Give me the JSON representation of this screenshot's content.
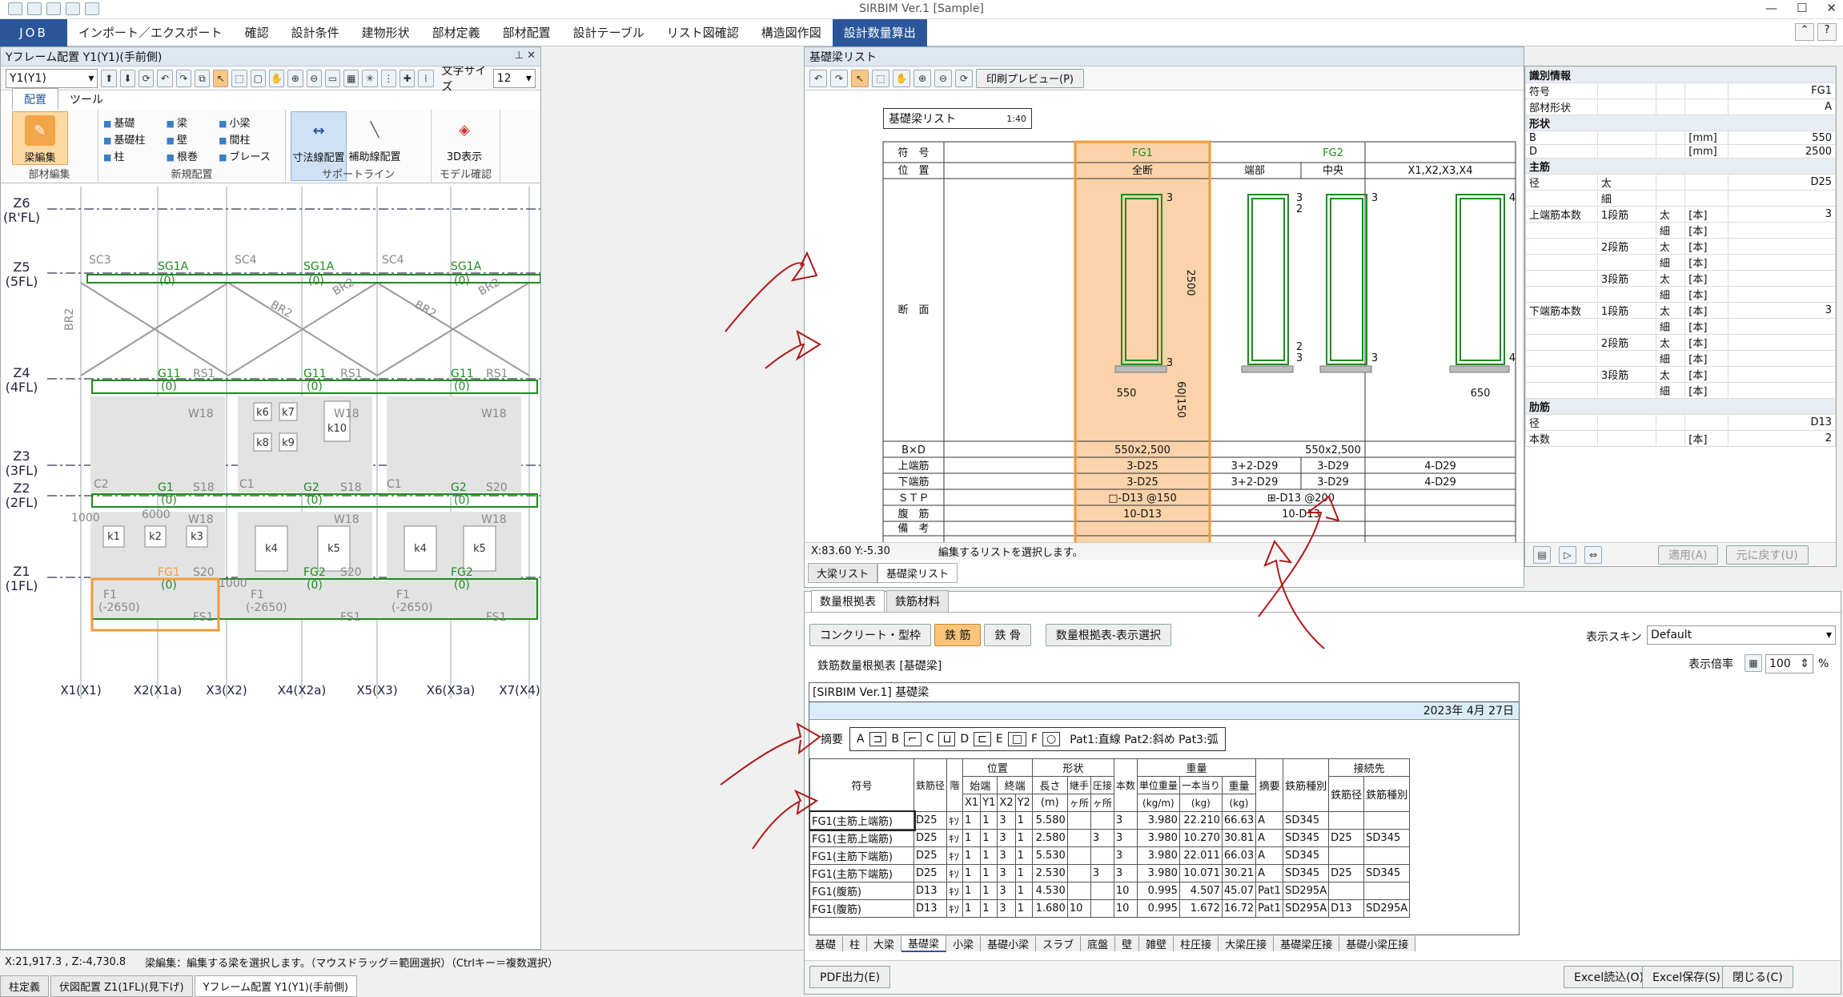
{
  "app": {
    "title": "SIRBIM Ver.1 [Sample]",
    "job": "JOB",
    "tabs": [
      "インポート／エクスポート",
      "確認",
      "設計条件",
      "建物形状",
      "部材定義",
      "部材配置",
      "設計テーブル",
      "リスト図確認",
      "構造図作図",
      "設計数量算出"
    ],
    "active_tab": "設計数量算出",
    "win_controls": [
      "—",
      "☐",
      "✕"
    ]
  },
  "left": {
    "panel_title": "Yフレーム配置 Y1(Y1)(手前側)",
    "frame_select": "Y1(Y1)",
    "font_size_label": "文字サイズ",
    "font_size_value": "12",
    "subtabs": [
      "配置",
      "ツール"
    ],
    "ribbon": {
      "edit_btn": "梁編集",
      "edit_group": "部材編集",
      "new_items": [
        "基礎",
        "梁",
        "小梁",
        "基礎柱",
        "壁",
        "間柱",
        "柱",
        "根巻",
        "ブレース"
      ],
      "new_group": "新規配置",
      "dim_btn": "寸法線配置",
      "aux_btn": "補助線配置",
      "support_group": "サポートライン",
      "view3d_btn": "3D表示",
      "model_group": "モデル確認"
    },
    "levels": [
      {
        "name": "Z6",
        "sub": "(R'FL)"
      },
      {
        "name": "Z5",
        "sub": "(5FL)"
      },
      {
        "name": "Z4",
        "sub": "(4FL)"
      },
      {
        "name": "Z3",
        "sub": "(3FL)"
      },
      {
        "name": "Z2",
        "sub": "(2FL)"
      },
      {
        "name": "Z1",
        "sub": "(1FL)"
      }
    ],
    "axes": [
      "X1(X1)",
      "X2(X1a)",
      "X3(X2)",
      "X4(X2a)",
      "X5(X3)",
      "X6(X3a)",
      "X7(X4)"
    ],
    "labels": {
      "sc3": "SC3",
      "sc4": "SC4",
      "sc4b": "SC4",
      "sg1a": "SG1A",
      "zero": "(0)",
      "br2": "BR2",
      "br2v": "BR2",
      "g11": "G11",
      "rs1": "RS1",
      "w18": "W18",
      "g1": "G1",
      "s18": "S18",
      "s20": "S20",
      "g2": "G2",
      "c2": "C2",
      "c1": "C1",
      "fg1": "FG1",
      "fg2": "FG2",
      "f1": "F1",
      "depth": "(-2650)",
      "fs1": "FS1",
      "dim6000": "6000",
      "dim1000": "1000",
      "k1": "k1",
      "k2": "k2",
      "k3": "k3",
      "k4": "k4",
      "k5": "k5",
      "k6": "k6",
      "k7": "k7",
      "k8": "k8",
      "k9": "k9",
      "k10": "k10"
    },
    "status_coord": "X:21,917.3 , Z:-4,730.8",
    "status_msg": "梁編集：編集する梁を選択します。（マウスドラッグ＝範囲選択）（Ctrlキー＝複数選択）",
    "doc_tabs": [
      "柱定義",
      "伏図配置 Z1(1FL)(見下げ)",
      "Yフレーム配置 Y1(Y1)(手前側)"
    ]
  },
  "list": {
    "panel_title": "基礎梁リスト",
    "print_preview": "印刷プレビュー(P)",
    "sheet_title": "基礎梁リスト",
    "scale": "1:40",
    "row_labels": [
      "符　号",
      "位　置",
      "断　面",
      "B×D",
      "上端筋",
      "下端筋",
      "ＳＴＰ",
      "腹　筋",
      "備　考"
    ],
    "fg1": {
      "name": "FG1",
      "pos": "全断",
      "bd": "550x2,500",
      "top": "3-D25",
      "bot": "3-D25",
      "stp": "□-D13 @150",
      "side": "10-D13",
      "w": "550",
      "h": "2500",
      "cover": "60|150",
      "n_top": "3",
      "n_bot": "3"
    },
    "fg2": {
      "name": "FG2",
      "pos_end": "端部",
      "pos_mid": "中央",
      "bd": "550x2,500",
      "top_end": "3+2-D29",
      "top_mid": "3-D29",
      "bot_end": "3+2-D29",
      "bot_mid": "3-D29",
      "stp": "⊞-D13 @200",
      "side": "10-D13",
      "n_top_end": "3",
      "n_top_end2": "2",
      "n_bot_end": "2",
      "n_bot_end2": "3",
      "n_top_mid": "3",
      "n_bot_mid": "3"
    },
    "x1": {
      "name": "X1,X2,X3,X4",
      "top": "4-D29",
      "bot": "4-D29",
      "w": "650",
      "n_top": "4",
      "n_bot": "4"
    },
    "coord": "X:83.60  Y:-5.30",
    "status": "編集するリストを選択します。",
    "tabs": [
      "大梁リスト",
      "基礎梁リスト"
    ]
  },
  "props": {
    "rows": [
      {
        "k": "識別情報",
        "sec": true
      },
      {
        "k": "符号",
        "v": "FG1"
      },
      {
        "k": "部材形状",
        "v": "A"
      },
      {
        "k": "形状",
        "sec": true
      },
      {
        "k": "B",
        "u": "[mm]",
        "v": "550"
      },
      {
        "k": "D",
        "u": "[mm]",
        "v": "2500"
      },
      {
        "k": "主筋",
        "sec": true
      },
      {
        "k": "径",
        "s": "太",
        "v": "D25"
      },
      {
        "k": "",
        "s": "細",
        "v": ""
      },
      {
        "k": "上端筋本数",
        "s": "1段筋",
        "s2": "太",
        "u": "[本]",
        "v": "3"
      },
      {
        "k": "",
        "s": "",
        "s2": "細",
        "u": "[本]",
        "v": ""
      },
      {
        "k": "",
        "s": "2段筋",
        "s2": "太",
        "u": "[本]",
        "v": ""
      },
      {
        "k": "",
        "s": "",
        "s2": "細",
        "u": "[本]",
        "v": ""
      },
      {
        "k": "",
        "s": "3段筋",
        "s2": "太",
        "u": "[本]",
        "v": ""
      },
      {
        "k": "",
        "s": "",
        "s2": "細",
        "u": "[本]",
        "v": ""
      },
      {
        "k": "下端筋本数",
        "s": "1段筋",
        "s2": "太",
        "u": "[本]",
        "v": "3"
      },
      {
        "k": "",
        "s": "",
        "s2": "細",
        "u": "[本]",
        "v": ""
      },
      {
        "k": "",
        "s": "2段筋",
        "s2": "太",
        "u": "[本]",
        "v": ""
      },
      {
        "k": "",
        "s": "",
        "s2": "細",
        "u": "[本]",
        "v": ""
      },
      {
        "k": "",
        "s": "3段筋",
        "s2": "太",
        "u": "[本]",
        "v": ""
      },
      {
        "k": "",
        "s": "",
        "s2": "細",
        "u": "[本]",
        "v": ""
      },
      {
        "k": "肋筋",
        "sec": true
      },
      {
        "k": "径",
        "v": "D13"
      },
      {
        "k": "本数",
        "u": "[本]",
        "v": "2"
      }
    ],
    "apply": "適用(A)",
    "reset": "元に戻す(U)"
  },
  "qty": {
    "tabs": [
      "数量根拠表",
      "鉄筋材料"
    ],
    "kinds": [
      "コンクリート・型枠",
      "鉄 筋",
      "鉄 骨"
    ],
    "active_kind": "鉄 筋",
    "display_select": "数量根拠表-表示選択",
    "skin_label": "表示スキン",
    "skin_value": "Default",
    "zoom_label": "表示倍率",
    "zoom_value": "100",
    "zoom_unit": "%",
    "heading": "鉄筋数量根拠表 [基礎梁]",
    "sheet_head": "[SIRBIM  Ver.1] 基礎梁",
    "date": "2023年  4月 27日",
    "summary_label": "摘要",
    "shapes": [
      "A",
      "B",
      "C",
      "D",
      "E",
      "F"
    ],
    "patterns": "Pat1:直線  Pat2:斜め  Pat3:弧",
    "headers": {
      "mark": "符号",
      "dia": "鉄筋径",
      "floor": "階",
      "pos": "位置",
      "start": "始端",
      "end": "終端",
      "shape": "形状",
      "len": "長さ",
      "joint": "継手",
      "press": "圧接",
      "count": "本数",
      "weight": "重量",
      "unitw": "単位重量",
      "per": "一本当り",
      "wt": "重量",
      "sub": "摘要",
      "kind": "鉄筋種別",
      "conn": "接続先",
      "cdia": "鉄筋径",
      "ckind": "鉄筋種別",
      "x1": "X1",
      "y1": "Y1",
      "x2": "X2",
      "y2": "Y2",
      "m": "(m)",
      "place": "ヶ所",
      "kgm": "(kg/m)",
      "kg": "(kg)"
    },
    "rows": [
      [
        "FG1(主筋上端筋)",
        "D25",
        "ｷｿ",
        "1",
        "1",
        "3",
        "1",
        "5.580",
        "",
        "",
        "3",
        "3.980",
        "22.210",
        "66.63",
        "A",
        "SD345",
        "",
        ""
      ],
      [
        "FG1(主筋上端筋)",
        "D25",
        "ｷｿ",
        "1",
        "1",
        "3",
        "1",
        "2.580",
        "",
        "3",
        "3",
        "3.980",
        "10.270",
        "30.81",
        "A",
        "SD345",
        "D25",
        "SD345"
      ],
      [
        "FG1(主筋下端筋)",
        "D25",
        "ｷｿ",
        "1",
        "1",
        "3",
        "1",
        "5.530",
        "",
        "",
        "3",
        "3.980",
        "22.011",
        "66.03",
        "A",
        "SD345",
        "",
        ""
      ],
      [
        "FG1(主筋下端筋)",
        "D25",
        "ｷｿ",
        "1",
        "1",
        "3",
        "1",
        "2.530",
        "",
        "3",
        "3",
        "3.980",
        "10.071",
        "30.21",
        "A",
        "SD345",
        "D25",
        "SD345"
      ],
      [
        "FG1(腹筋)",
        "D13",
        "ｷｿ",
        "1",
        "1",
        "3",
        "1",
        "4.530",
        "",
        "",
        "10",
        "0.995",
        "4.507",
        "45.07",
        "Pat1",
        "SD295A",
        "",
        ""
      ],
      [
        "FG1(腹筋)",
        "D13",
        "ｷｿ",
        "1",
        "1",
        "3",
        "1",
        "1.680",
        "10",
        "",
        "10",
        "0.995",
        "1.672",
        "16.72",
        "Pat1",
        "SD295A",
        "D13",
        "SD295A"
      ]
    ],
    "sheet_tabs": [
      "基礎",
      "柱",
      "大梁",
      "基礎梁",
      "小梁",
      "基礎小梁",
      "スラブ",
      "底盤",
      "壁",
      "雑壁",
      "柱圧接",
      "大梁圧接",
      "基礎梁圧接",
      "基礎小梁圧接"
    ],
    "active_sheet": "基礎梁",
    "pdf": "PDF出力(E)",
    "excel_load": "Excel読込(O)",
    "excel_save": "Excel保存(S)",
    "close": "閉じる(C)"
  },
  "colors": {
    "accent": "#2b579a",
    "highlight": "#f29b37",
    "beam_green": "#1f8a1f",
    "arrow_red": "#b01818"
  }
}
